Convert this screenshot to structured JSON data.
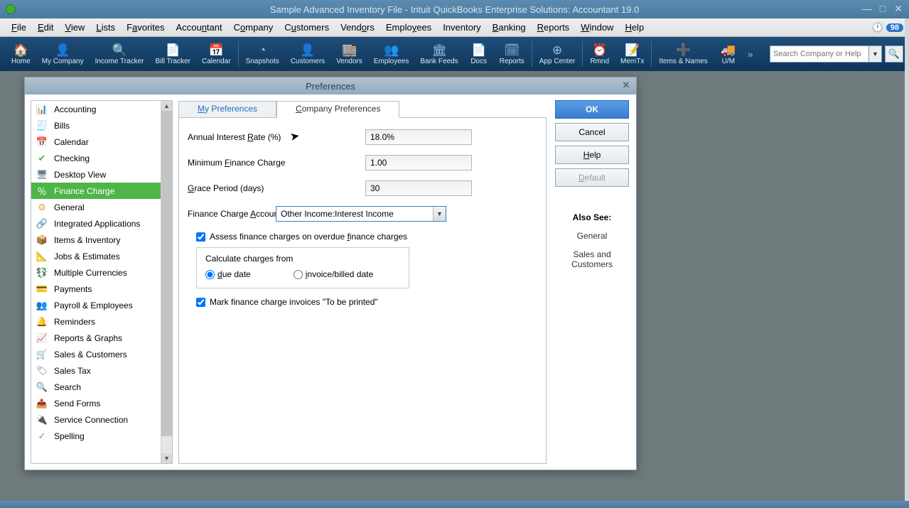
{
  "window": {
    "title": "Sample Advanced Inventory File  - Intuit QuickBooks Enterprise Solutions: Accountant 19.0"
  },
  "menubar": {
    "items": [
      "File",
      "Edit",
      "View",
      "Lists",
      "Favorites",
      "Accountant",
      "Company",
      "Customers",
      "Vendors",
      "Employees",
      "Inventory",
      "Banking",
      "Reports",
      "Window",
      "Help"
    ],
    "badge": "98"
  },
  "toolbar": {
    "items": [
      {
        "icon": "🏠",
        "label": "Home"
      },
      {
        "icon": "👤",
        "label": "My Company"
      },
      {
        "icon": "🔍",
        "label": "Income Tracker"
      },
      {
        "icon": "📄",
        "label": "Bill Tracker"
      },
      {
        "icon": "📅",
        "label": "Calendar"
      }
    ],
    "items2": [
      {
        "icon": "◔",
        "label": "Snapshots"
      },
      {
        "icon": "👤",
        "label": "Customers"
      },
      {
        "icon": "🏬",
        "label": "Vendors"
      },
      {
        "icon": "👥",
        "label": "Employees"
      },
      {
        "icon": "🏛",
        "label": "Bank Feeds"
      },
      {
        "icon": "📄",
        "label": "Docs"
      },
      {
        "icon": "🗓",
        "label": "Reports"
      }
    ],
    "items3": [
      {
        "icon": "⊕",
        "label": "App Center"
      }
    ],
    "items4": [
      {
        "icon": "⏰",
        "label": "Rmnd"
      },
      {
        "icon": "📝",
        "label": "MemTx"
      }
    ],
    "items5": [
      {
        "icon": "➕",
        "label": "Items & Names"
      },
      {
        "icon": "🚚",
        "label": "U/M"
      }
    ],
    "search_placeholder": "Search Company or Help"
  },
  "dialog": {
    "title": "Preferences",
    "categories": [
      {
        "icon": "📊",
        "label": "Accounting",
        "color": "#e8a33a"
      },
      {
        "icon": "🧾",
        "label": "Bills",
        "color": "#5aa0d8"
      },
      {
        "icon": "📅",
        "label": "Calendar",
        "color": "#5aa0d8"
      },
      {
        "icon": "✔",
        "label": "Checking",
        "color": "#4eb548"
      },
      {
        "icon": "🖥",
        "label": "Desktop View",
        "color": "#6a7a8a"
      },
      {
        "icon": "％",
        "label": "Finance Charge",
        "color": "#8a5ab8",
        "selected": true
      },
      {
        "icon": "⚙",
        "label": "General",
        "color": "#e8a33a"
      },
      {
        "icon": "🔗",
        "label": "Integrated Applications",
        "color": "#5aa0d8"
      },
      {
        "icon": "📦",
        "label": "Items & Inventory",
        "color": "#e8a33a"
      },
      {
        "icon": "📐",
        "label": "Jobs & Estimates",
        "color": "#e8a33a"
      },
      {
        "icon": "💱",
        "label": "Multiple Currencies",
        "color": "#4eb548"
      },
      {
        "icon": "💳",
        "label": "Payments",
        "color": "#4eb548"
      },
      {
        "icon": "👥",
        "label": "Payroll & Employees",
        "color": "#6a7a8a"
      },
      {
        "icon": "🔔",
        "label": "Reminders",
        "color": "#e8a33a"
      },
      {
        "icon": "📈",
        "label": "Reports & Graphs",
        "color": "#c84a4a"
      },
      {
        "icon": "🛒",
        "label": "Sales & Customers",
        "color": "#c84a4a"
      },
      {
        "icon": "🏷",
        "label": "Sales Tax",
        "color": "#6a7a8a"
      },
      {
        "icon": "🔍",
        "label": "Search",
        "color": "#6a7a8a"
      },
      {
        "icon": "📤",
        "label": "Send Forms",
        "color": "#5aa0d8"
      },
      {
        "icon": "🔌",
        "label": "Service Connection",
        "color": "#6a7a8a"
      },
      {
        "icon": "✓",
        "label": "Spelling",
        "color": "#4eb548"
      }
    ],
    "tabs": {
      "my": "My Preferences",
      "company": "Company Preferences"
    },
    "fields": {
      "annual_rate_label": "Annual Interest Rate (%)",
      "annual_rate_value": "18.0%",
      "min_charge_label": "Minimum Finance Charge",
      "min_charge_value": "1.00",
      "grace_label": "Grace Period (days)",
      "grace_value": "30",
      "account_label": "Finance Charge Account",
      "account_value": "Other Income:Interest Income",
      "assess_label": "Assess finance charges on overdue finance charges",
      "calc_from_label": "Calculate charges from",
      "due_date_label": "due date",
      "invoice_date_label": "invoice/billed date",
      "mark_printed_label": "Mark finance charge invoices \"To be printed\""
    },
    "buttons": {
      "ok": "OK",
      "cancel": "Cancel",
      "help": "Help",
      "default": "Default"
    },
    "also_see": {
      "heading": "Also See:",
      "links": [
        "General",
        "Sales and Customers"
      ]
    }
  }
}
